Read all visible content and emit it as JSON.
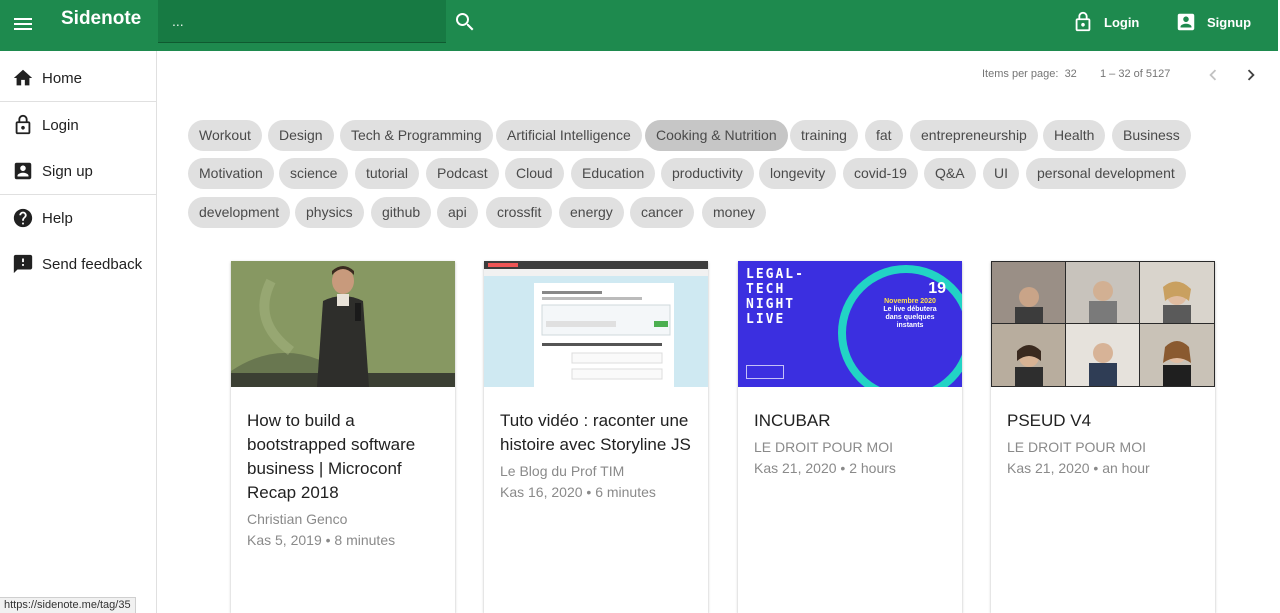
{
  "header": {
    "brand": "Sidenote",
    "search_placeholder": "...",
    "login_label": "Login",
    "signup_label": "Signup"
  },
  "sidebar": {
    "items": [
      {
        "label": "Home",
        "icon": "home-icon"
      },
      {
        "label": "Login",
        "icon": "lock-icon"
      },
      {
        "label": "Sign up",
        "icon": "account-box-icon"
      },
      {
        "label": "Help",
        "icon": "help-icon"
      },
      {
        "label": "Send feedback",
        "icon": "feedback-icon"
      }
    ]
  },
  "pager": {
    "items_per_page_label": "Items per page:",
    "items_per_page_value": "32",
    "range": "1 – 32 of 5127"
  },
  "tags": {
    "row1": [
      "Workout",
      "Design",
      "Tech & Programming",
      "Artificial Intelligence",
      "Cooking & Nutrition",
      "training",
      "fat",
      "entrepreneurship",
      "Health",
      "Business"
    ],
    "row2": [
      "Motivation",
      "science",
      "tutorial",
      "Podcast",
      "Cloud",
      "Education",
      "productivity",
      "longevity",
      "covid-19",
      "Q&A",
      "UI",
      "personal development"
    ],
    "row3": [
      "development",
      "physics",
      "github",
      "api",
      "crossfit",
      "energy",
      "cancer",
      "money"
    ],
    "active": "Cooking & Nutrition"
  },
  "cards": [
    {
      "title": "How to build a bootstrapped software business | Microconf Recap 2018",
      "author": "Christian Genco",
      "meta": "Kas 5, 2019 • 8 minutes"
    },
    {
      "title": "Tuto vidéo : raconter une histoire avec Storyline JS",
      "author": "Le Blog du Prof TIM",
      "meta": "Kas 16, 2020 • 6 minutes"
    },
    {
      "title": "INCUBAR",
      "author": "LE DROIT POUR MOI",
      "meta": "Kas 21, 2020 • 2 hours"
    },
    {
      "title": "PSEUD V4",
      "author": "LE DROIT POUR MOI",
      "meta": "Kas 21, 2020 • an hour"
    }
  ],
  "thumb_text": {
    "legaltech_lines": [
      "LEGAL-",
      "TECH",
      "NIGHT",
      "LIVE"
    ],
    "legaltech_day": "19",
    "legaltech_month": "Novembre 2020",
    "legaltech_note_1": "Le live débutera",
    "legaltech_note_2": "dans quelques",
    "legaltech_note_3": "instants"
  },
  "status_url": "https://sidenote.me/tag/35",
  "colors": {
    "header_green": "#1e8a4e",
    "chip_bg": "#e0e0e0",
    "chip_active_bg": "#c6c6c6",
    "legaltech_blue": "#3b2fe0",
    "legaltech_teal": "#22d3c5"
  }
}
